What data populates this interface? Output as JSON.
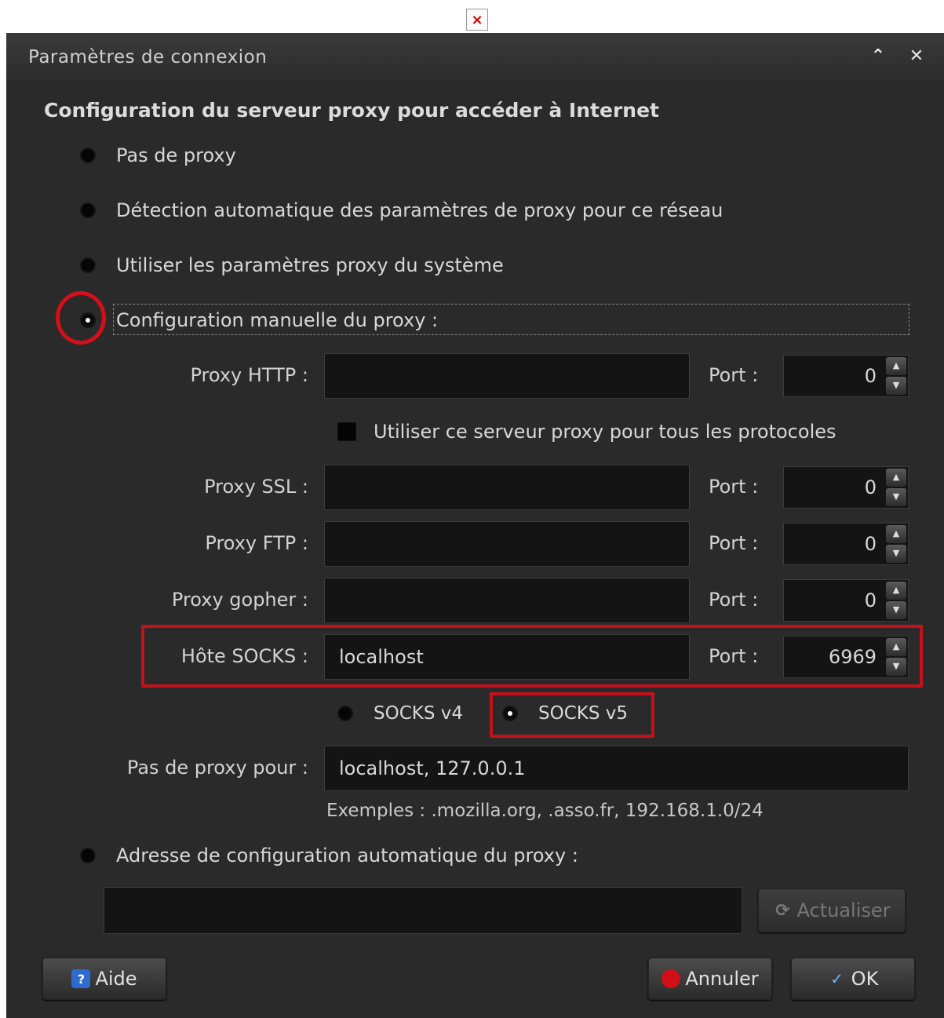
{
  "window": {
    "title": "Paramètres de connexion"
  },
  "heading": "Configuration du serveur proxy pour accéder à Internet",
  "options": {
    "no_proxy": "Pas de proxy",
    "auto_detect": "Détection automatique des paramètres de proxy pour ce réseau",
    "system": "Utiliser les paramètres proxy du système",
    "manual": "Configuration manuelle du proxy :",
    "auto_config_url": "Adresse de configuration automatique du proxy :"
  },
  "selected_option": "manual",
  "fields": {
    "http": {
      "label": "Proxy HTTP :",
      "value": "",
      "port_label": "Port :",
      "port": "0"
    },
    "ssl": {
      "label": "Proxy SSL :",
      "value": "",
      "port_label": "Port :",
      "port": "0"
    },
    "ftp": {
      "label": "Proxy FTP :",
      "value": "",
      "port_label": "Port :",
      "port": "0"
    },
    "gopher": {
      "label": "Proxy gopher :",
      "value": "",
      "port_label": "Port :",
      "port": "0"
    },
    "socks": {
      "label": "Hôte SOCKS :",
      "value": "localhost",
      "port_label": "Port :",
      "port": "6969"
    }
  },
  "use_for_all": {
    "label": "Utiliser ce serveur proxy pour tous les protocoles",
    "checked": false
  },
  "socks_version": {
    "v4": "SOCKS v4",
    "v5": "SOCKS v5",
    "selected": "v5"
  },
  "no_proxy_for": {
    "label": "Pas de proxy pour :",
    "value": "localhost, 127.0.0.1"
  },
  "examples": "Exemples : .mozilla.org, .asso.fr, 192.168.1.0/24",
  "auto_config_value": "",
  "buttons": {
    "refresh": "Actualiser",
    "help": "Aide",
    "cancel": "Annuler",
    "ok": "OK"
  },
  "icons": {
    "broken_image": "×",
    "titlebar_up": "⌃",
    "titlebar_close": "✕"
  },
  "highlight_color": "#d40f1a"
}
